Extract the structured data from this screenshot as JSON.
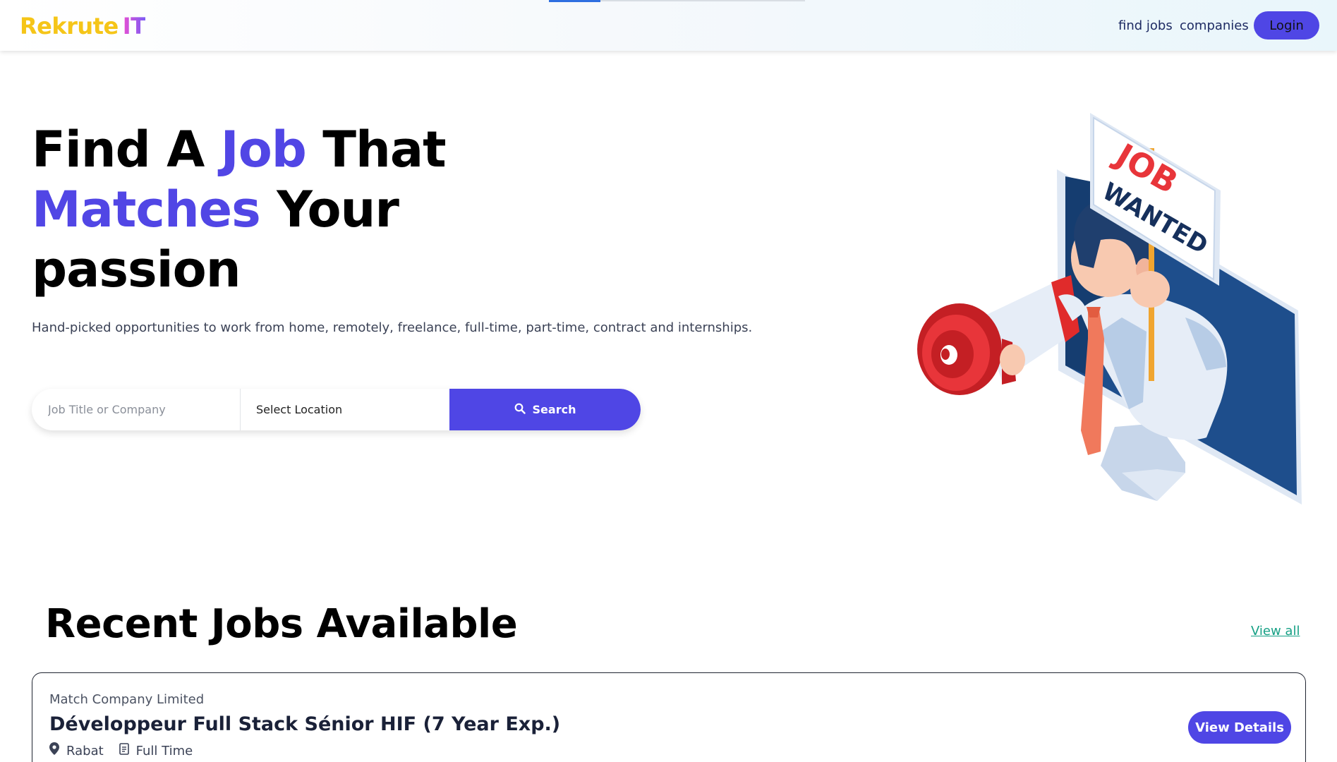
{
  "navbar": {
    "brand_part1": "Rekrute",
    "brand_part2": "IT",
    "links": [
      {
        "label": "find jobs"
      },
      {
        "label": "companies"
      }
    ],
    "login_label": "Login",
    "load_progress": 0.2
  },
  "hero": {
    "title_words": {
      "w1": "Find A ",
      "w2": "Job",
      "w3": " That",
      "w4": "Matches",
      "w5": " Your",
      "w6": "passion"
    },
    "subtitle": "Hand-picked opportunities to work from home, remotely, freelance, full-time, part-time, contract and internships.",
    "illustration_sign": {
      "line1": "JOB",
      "line2": "WANTED"
    }
  },
  "search": {
    "query_placeholder": "Job Title or Company",
    "query_value": "",
    "location_value": "Select Location",
    "button_label": "Search",
    "button_icon": "search-icon"
  },
  "recent_jobs": {
    "heading": "Recent Jobs Available",
    "view_all_label": "View all",
    "jobs": [
      {
        "company": "Match Company Limited",
        "title": "Développeur Full Stack Sénior HIF (7 Year Exp.)",
        "location": "Rabat",
        "location_icon": "map-pin-icon",
        "type": "Full Time",
        "type_icon": "document-icon",
        "action_label": "View Details"
      }
    ]
  },
  "colors": {
    "accent": "#4f46e5",
    "brand_yellow": "#f5c518",
    "link_green": "#16a085"
  }
}
